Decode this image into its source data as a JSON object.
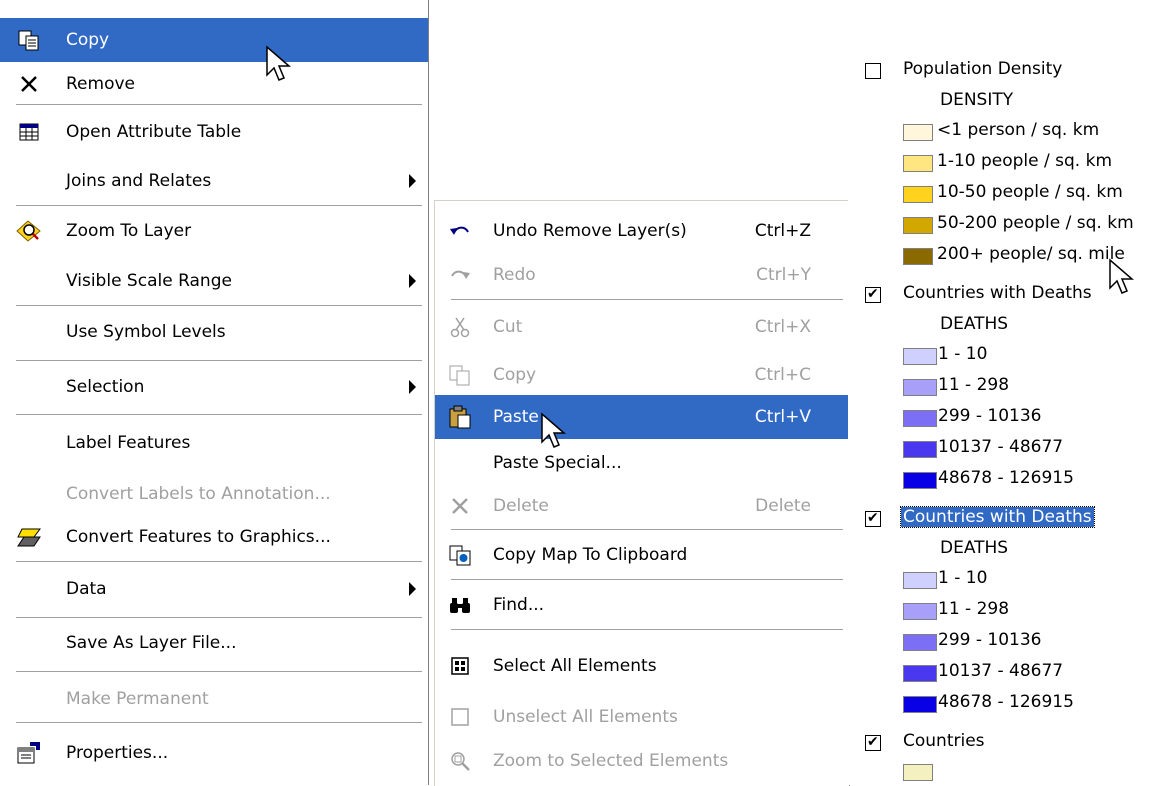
{
  "left_menu": {
    "items": [
      {
        "label": "Copy"
      },
      {
        "label": "Remove"
      },
      {
        "label": "Open Attribute Table"
      },
      {
        "label": "Joins and Relates"
      },
      {
        "label": "Zoom To Layer"
      },
      {
        "label": "Visible Scale Range"
      },
      {
        "label": "Use Symbol Levels"
      },
      {
        "label": "Selection"
      },
      {
        "label": "Label Features"
      },
      {
        "label": "Convert Labels to Annotation..."
      },
      {
        "label": "Convert Features to Graphics..."
      },
      {
        "label": "Data"
      },
      {
        "label": "Save As Layer File..."
      },
      {
        "label": "Make Permanent"
      },
      {
        "label": "Properties..."
      }
    ]
  },
  "mid_menu": {
    "items": [
      {
        "label": "Undo Remove Layer(s)",
        "shortcut": "Ctrl+Z"
      },
      {
        "label": "Redo",
        "shortcut": "Ctrl+Y"
      },
      {
        "label": "Cut",
        "shortcut": "Ctrl+X"
      },
      {
        "label": "Copy",
        "shortcut": "Ctrl+C"
      },
      {
        "label": "Paste",
        "shortcut": "Ctrl+V"
      },
      {
        "label": "Paste Special...",
        "shortcut": ""
      },
      {
        "label": "Delete",
        "shortcut": "Delete"
      },
      {
        "label": "Copy Map To Clipboard",
        "shortcut": ""
      },
      {
        "label": "Find...",
        "shortcut": ""
      },
      {
        "label": "Select All Elements",
        "shortcut": ""
      },
      {
        "label": "Unselect All Elements",
        "shortcut": ""
      },
      {
        "label": "Zoom to Selected Elements",
        "shortcut": ""
      }
    ]
  },
  "toc": {
    "layers": [
      {
        "name": "Population Density",
        "checked": false,
        "field": "DENSITY",
        "classes": [
          {
            "label": "<1 person / sq. km",
            "color": "#fff6dc"
          },
          {
            "label": "1-10 people / sq. km",
            "color": "#ffe680"
          },
          {
            "label": "10-50 people / sq. km",
            "color": "#ffd21e"
          },
          {
            "label": "50-200 people / sq. km",
            "color": "#d2a800"
          },
          {
            "label": "200+ people/ sq. mile",
            "color": "#8a6a00"
          }
        ]
      },
      {
        "name": "Countries with Deaths",
        "checked": true,
        "field": "DEATHS",
        "classes": [
          {
            "label": "1 - 10",
            "color": "#d0d0ff"
          },
          {
            "label": "11 - 298",
            "color": "#a8a0f8"
          },
          {
            "label": "299 - 10136",
            "color": "#7c6ef5"
          },
          {
            "label": "10137 - 48677",
            "color": "#4a38f0"
          },
          {
            "label": "48678 - 126915",
            "color": "#0a00e6"
          }
        ]
      },
      {
        "name": "Countries with Deaths",
        "checked": true,
        "field": "DEATHS",
        "classes": [
          {
            "label": "1 - 10",
            "color": "#d0d0ff"
          },
          {
            "label": "11 - 298",
            "color": "#a8a0f8"
          },
          {
            "label": "299 - 10136",
            "color": "#7c6ef5"
          },
          {
            "label": "10137 - 48677",
            "color": "#4a38f0"
          },
          {
            "label": "48678 - 126915",
            "color": "#0a00e6"
          }
        ]
      },
      {
        "name": "Countries",
        "checked": true,
        "field": "",
        "classes": [
          {
            "label": "",
            "color": "#f4f0c0"
          }
        ]
      }
    ]
  },
  "colors": {
    "highlight": "#316ac5",
    "disabled": "#a0a0a0"
  }
}
